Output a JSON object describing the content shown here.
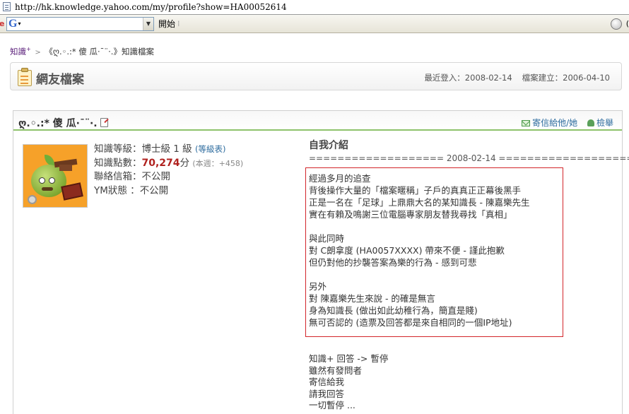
{
  "browser": {
    "url": "http://hk.knowledge.yahoo.com/my/profile?show=HA00052614",
    "toolbar": {
      "left_fragment": "e",
      "search_logo": "G",
      "search_placeholder": "",
      "go_label": "開始",
      "separator": "⁞",
      "right_fragment": "("
    }
  },
  "breadcrumb": {
    "root": "知識",
    "root_plus": "+",
    "sep": ">",
    "user": "《ღ.◦.:* 傻 瓜·¯¨·.》",
    "current": "知識檔案"
  },
  "header": {
    "title": "網友檔案",
    "last_login": "最近登入：2008-02-14",
    "created": "檔案建立：2006-04-10"
  },
  "profile": {
    "username": "ღ.◦.:* 傻 瓜·¯¨·.",
    "actions": {
      "mail": "寄信給他/她",
      "report": "檢舉"
    },
    "level_label": "知識等級：",
    "level_value": "博士級 1 級",
    "level_link": "(等級表)",
    "points_label": "知識點數：",
    "points_value": "70,274",
    "points_unit": "分",
    "points_week": "(本週：+458)",
    "mailbox_label": "聯絡信箱：",
    "mailbox_value": "不公開",
    "ym_label": "YM狀態  ：",
    "ym_value": "不公開"
  },
  "intro": {
    "heading": "自我介紹",
    "date_line": "=================== 2008-02-14 ===================",
    "boxed_lines": [
      "經過多月的追查",
      "背後操作大量的「檔案暱稱」子戶的真真正正幕後黑手",
      "正是一名在「足球」上鼎鼎大名的某知識長 - 陳嘉樂先生",
      "實在有賴及鳴謝三位電腦專家朋友替我尋找「真相」",
      "",
      "與此同時",
      "對 C朗拿度 (HA0057XXXX) 帶來不便 - 謹此抱歉",
      "但仍對他的抄襲答案為樂的行為 - 感到可悲",
      "",
      "另外",
      "對 陳嘉樂先生來說 - 的確是無言",
      "身為知識長 (做出如此幼稚行為，簡直是賤)",
      "無可否認的 (造票及回答都是來自相同的一個IP地址)"
    ],
    "tail_lines": [
      "知識+ 回答 -> 暫停",
      "雖然有發問者",
      "寄信給我",
      "請我回答",
      "一切暫停 ..."
    ]
  }
}
